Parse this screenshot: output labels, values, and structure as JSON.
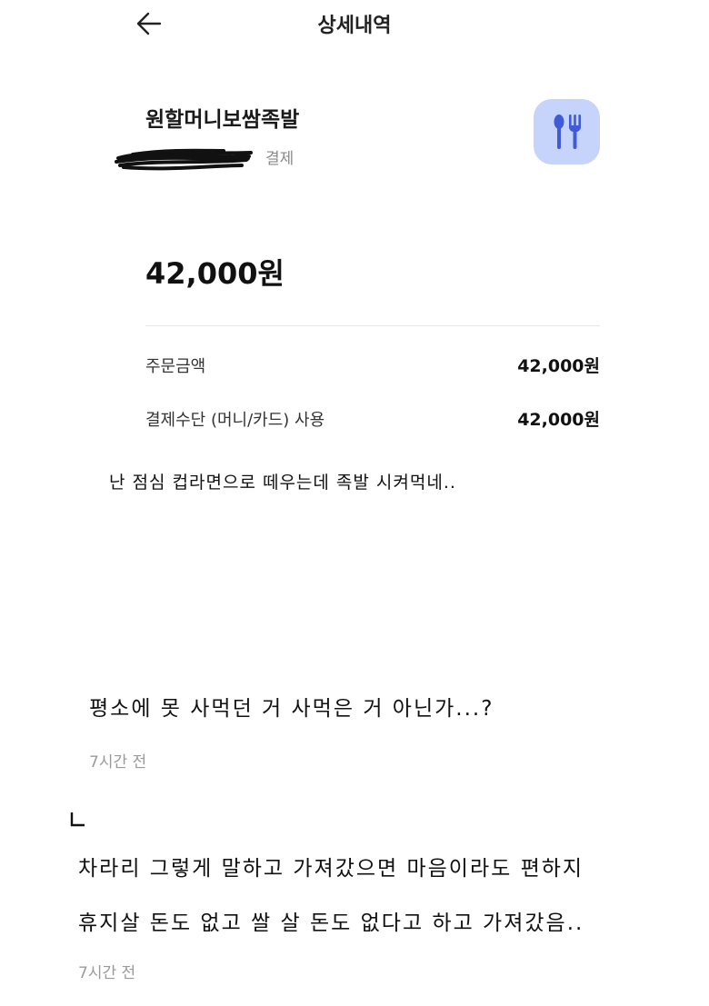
{
  "header": {
    "title": "상세내역",
    "back_icon": "arrow-left-icon"
  },
  "transaction": {
    "merchant": "원할머니보쌈족발",
    "status": "결제",
    "category_icon": "utensils-icon",
    "category_color": "#c6d4fb",
    "category_icon_color": "#3f5bd8",
    "total_amount": "42,000원",
    "rows": [
      {
        "label": "주문금액",
        "value": "42,000원"
      },
      {
        "label": "결제수단 (머니/카드) 사용",
        "value": "42,000원"
      }
    ]
  },
  "caption": "난 점심 컵라면으로 떼우는데 족발 시켜먹네..",
  "comments": [
    {
      "text": "평소에 못 사먹던 거 사먹은 거 아닌가...?",
      "time": "7시간 전"
    }
  ],
  "reply": {
    "lines": [
      "차라리 그렇게 말하고 가져갔으면 마음이라도 편하지",
      "휴지살 돈도 없고 쌀 살 돈도 없다고 하고 가져갔음.."
    ],
    "time": "7시간 전"
  }
}
